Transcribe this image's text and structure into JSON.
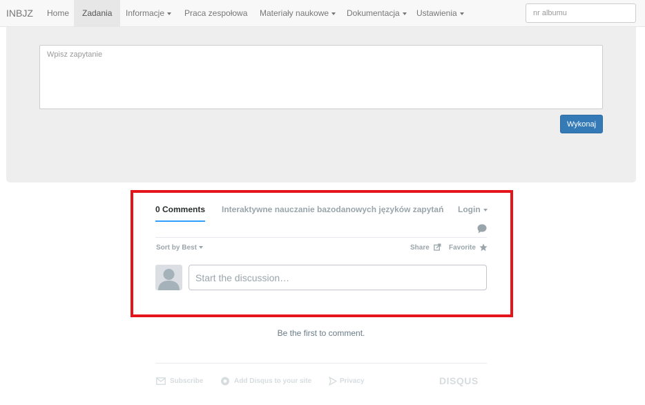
{
  "navbar": {
    "brand": "INBJZ",
    "items": [
      {
        "label": "Home"
      },
      {
        "label": "Zadania"
      },
      {
        "label": "Informacje"
      },
      {
        "label": "Praca zespołowa"
      },
      {
        "label": "Materiały naukowe"
      },
      {
        "label": "Dokumentacja"
      },
      {
        "label": "Ustawienia"
      }
    ],
    "active": "Zadania",
    "album_placeholder": "nr albumu"
  },
  "query": {
    "placeholder": "Wpisz zapytanie",
    "execute_label": "Wykonaj"
  },
  "disqus": {
    "comments_tab": "0 Comments",
    "thread_title": "Interaktywne nauczanie bazodanowych języków zapytań",
    "login_label": "Login",
    "sort_label": "Sort by Best",
    "share_label": "Share",
    "favorite_label": "Favorite",
    "discussion_placeholder": "Start the discussion…",
    "first_comment_text": "Be the first to comment.",
    "footer": {
      "subscribe": "Subscribe",
      "add_disqus": "Add Disqus to your site",
      "privacy": "Privacy",
      "logo": "DISQUS"
    }
  },
  "colors": {
    "highlight_border": "#e4141b",
    "primary_button": "#337ab7",
    "tab_underline": "#2e9fff"
  },
  "icons": [
    "chat-bubble-icon",
    "share-icon",
    "star-icon",
    "avatar-placeholder-icon",
    "envelope-icon",
    "disqus-d-icon",
    "privacy-icon"
  ]
}
